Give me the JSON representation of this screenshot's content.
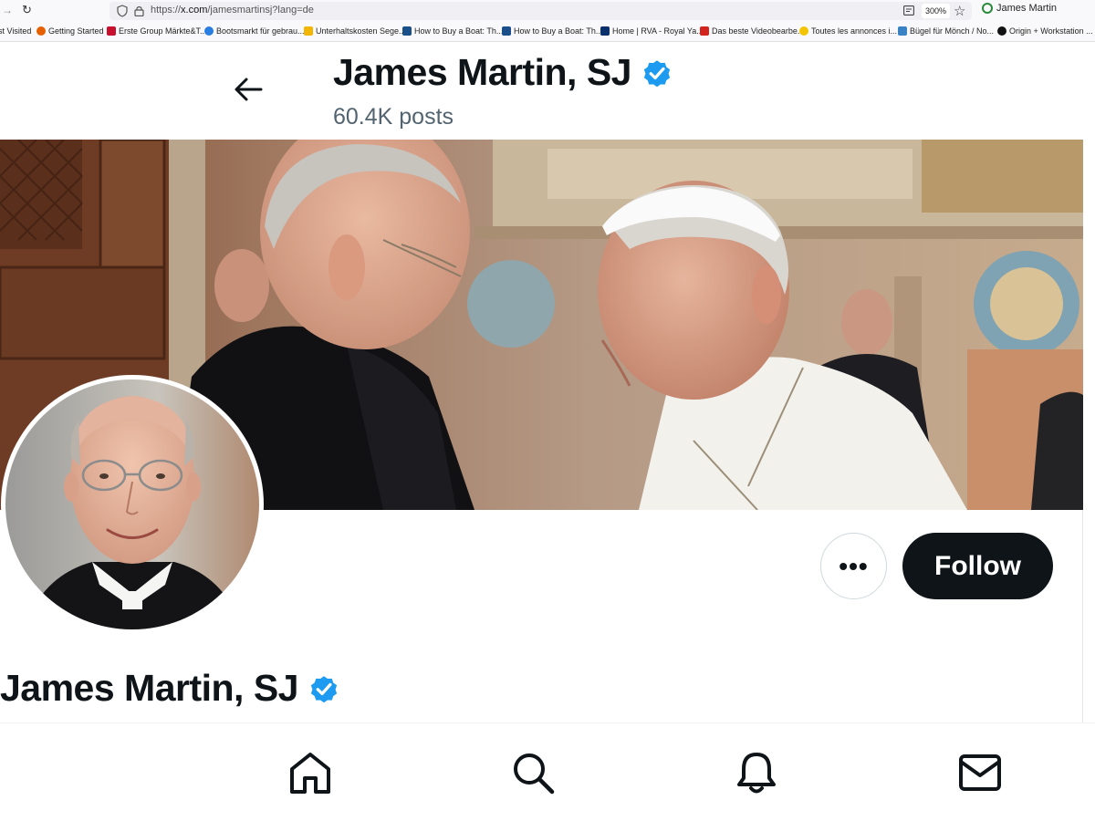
{
  "browser": {
    "url_prefix": "https://",
    "url_host": "x.com",
    "url_path": "/jamesmartinsj?lang=de",
    "zoom": "300%",
    "profile_name": "James Martin",
    "bookmarks": [
      {
        "label": "st Visited",
        "color": "#ffffff"
      },
      {
        "label": "Getting Started",
        "color": "#e66000"
      },
      {
        "label": "Erste Group Märkte&T...",
        "color": "#c8102e"
      },
      {
        "label": "Bootsmarkt für gebrau...",
        "color": "#2a7de1"
      },
      {
        "label": "Unterhaltskosten Sege...",
        "color": "#f2b600"
      },
      {
        "label": "How to Buy a Boat: Th...",
        "color": "#1b4f8a"
      },
      {
        "label": "How to Buy a Boat: Th...",
        "color": "#1b4f8a"
      },
      {
        "label": "Home | RVA - Royal Ya...",
        "color": "#0a2f6b"
      },
      {
        "label": "Das beste Videobearbe...",
        "color": "#d2231e"
      },
      {
        "label": "Toutes les annonces i...",
        "color": "#f5c400"
      },
      {
        "label": "Bügel für Mönch / No...",
        "color": "#3b82c4"
      },
      {
        "label": "Origin + Workstation ...",
        "color": "#111111"
      }
    ]
  },
  "header": {
    "name": "James Martin, SJ",
    "posts": "60.4K posts"
  },
  "actions": {
    "more_label": "•••",
    "follow_label": "Follow"
  },
  "profile": {
    "name": "James Martin, SJ"
  },
  "colors": {
    "verified": "#1d9bf0",
    "follow_bg": "#0f1419",
    "secondary_text": "#536471"
  },
  "nav_icons": [
    "home-icon",
    "search-icon",
    "notifications-icon",
    "messages-icon"
  ]
}
